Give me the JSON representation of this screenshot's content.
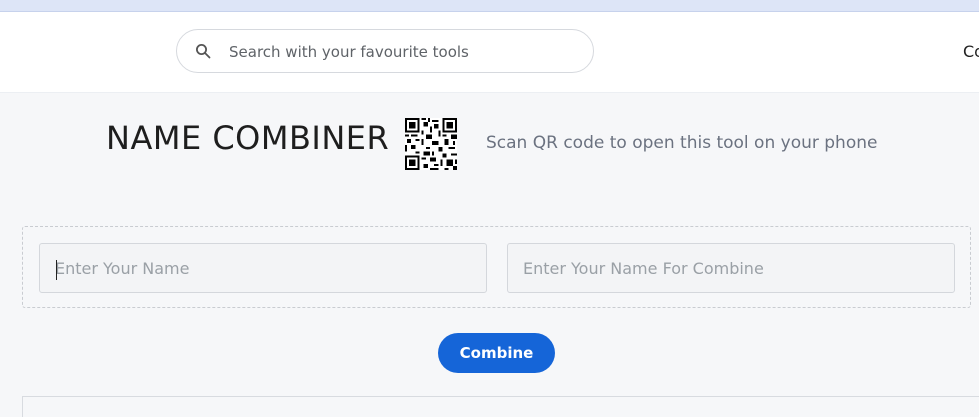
{
  "header": {
    "search": {
      "placeholder": "Search with your favourite tools",
      "icon": "search-icon"
    },
    "nav_partial": "Co"
  },
  "main": {
    "title": "NAME COMBINER",
    "qr": {
      "icon": "qr-code-icon",
      "caption": "Scan QR code to open this tool on your phone"
    },
    "form": {
      "name_placeholder": "Enter Your Name",
      "name_value": "",
      "combine_placeholder": "Enter Your Name For Combine",
      "combine_value": "",
      "combine_button": "Combine"
    }
  },
  "colors": {
    "accent": "#1565d8",
    "background": "#f6f7f9",
    "header_bg": "#ffffff"
  }
}
